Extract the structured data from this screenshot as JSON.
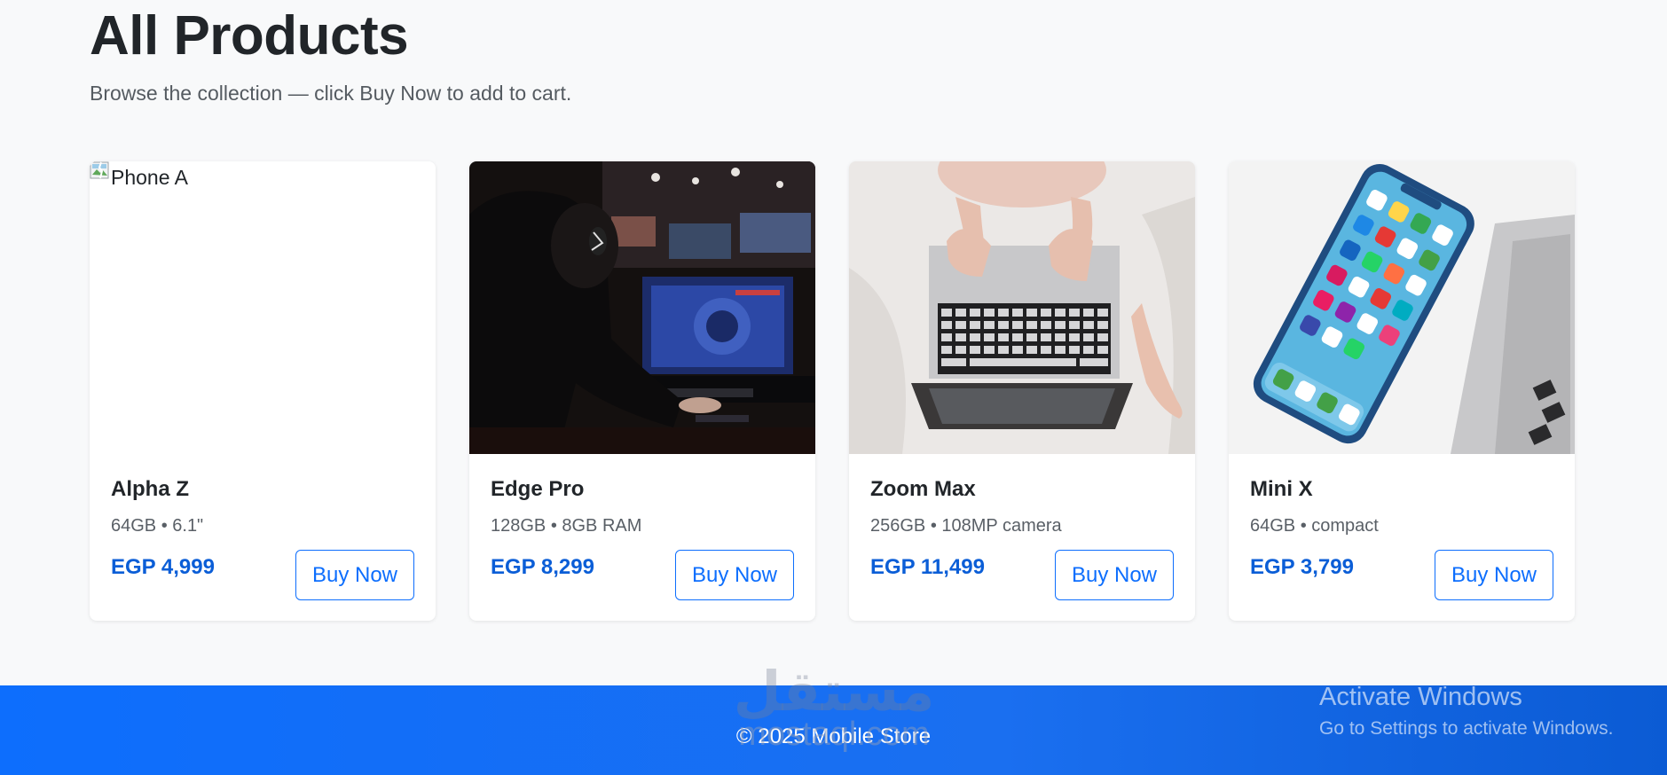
{
  "page": {
    "title": "All Products",
    "subtitle": "Browse the collection — click Buy Now to add to cart."
  },
  "products": [
    {
      "image_alt": "Phone A",
      "name": "Alpha Z",
      "spec": "64GB • 6.1\"",
      "price": "EGP 4,999",
      "button": "Buy Now"
    },
    {
      "image_alt": "",
      "name": "Edge Pro",
      "spec": "128GB • 8GB RAM",
      "price": "EGP 8,299",
      "button": "Buy Now"
    },
    {
      "image_alt": "",
      "name": "Zoom Max",
      "spec": "256GB • 108MP camera",
      "price": "EGP 11,499",
      "button": "Buy Now"
    },
    {
      "image_alt": "",
      "name": "Mini X",
      "spec": "64GB • compact",
      "price": "EGP 3,799",
      "button": "Buy Now"
    }
  ],
  "footer": {
    "copyright": "© 2025 Mobile Store"
  },
  "watermark": {
    "arabic": "مستقل",
    "latin": "mostaql.com"
  },
  "os_overlay": {
    "title": "Activate Windows",
    "subtitle": "Go to Settings to activate Windows."
  },
  "colors": {
    "primary": "#0d6efd",
    "price": "#0b5ed7",
    "background": "#f8f9fa"
  }
}
